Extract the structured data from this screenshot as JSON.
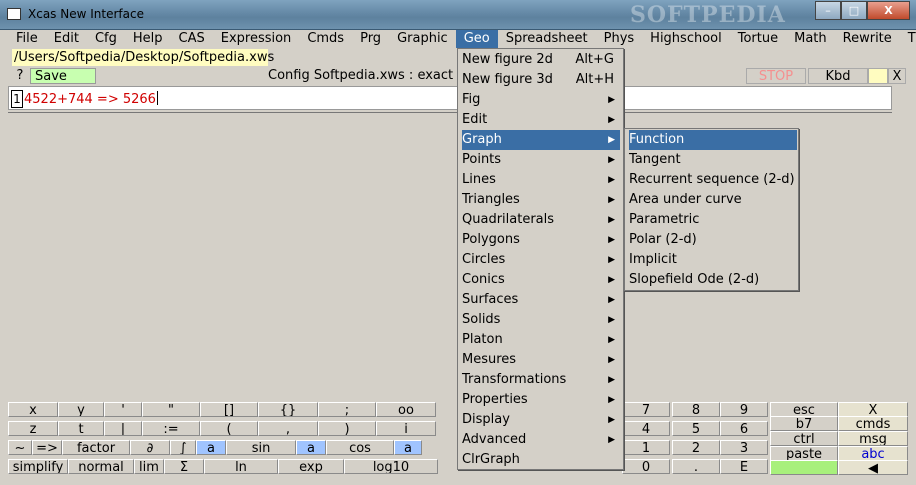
{
  "window": {
    "title": "Xcas New Interface",
    "watermark": "SOFTPEDIA",
    "min": "–",
    "max": "□",
    "close": "X"
  },
  "menubar": [
    "File",
    "Edit",
    "Cfg",
    "Help",
    "CAS",
    "Expression",
    "Cmds",
    "Prg",
    "Graphic",
    "Geo",
    "Spreadsheet",
    "Phys",
    "Highschool",
    "Tortue",
    "Math",
    "Rewrite",
    "T"
  ],
  "session": {
    "path": "/Users/Softpedia/Desktop/Softpedia.xws",
    "help": "?",
    "save": "Save",
    "config": "Config Softpedia.xws : exact re",
    "stop": "STOP",
    "kbd": "Kbd",
    "close": "X"
  },
  "editor": {
    "line": "1",
    "command": "4522+744 => 5266"
  },
  "geo_menu": [
    {
      "label": "New figure 2d",
      "shortcut": "Alt+G"
    },
    {
      "label": "New figure 3d",
      "shortcut": "Alt+H"
    },
    {
      "label": "Fig",
      "sub": true
    },
    {
      "label": "Edit",
      "sub": true
    },
    {
      "label": "Graph",
      "sub": true
    },
    {
      "label": "Points",
      "sub": true
    },
    {
      "label": "Lines",
      "sub": true
    },
    {
      "label": "Triangles",
      "sub": true
    },
    {
      "label": "Quadrilaterals",
      "sub": true
    },
    {
      "label": "Polygons",
      "sub": true
    },
    {
      "label": "Circles",
      "sub": true
    },
    {
      "label": "Conics",
      "sub": true
    },
    {
      "label": "Surfaces",
      "sub": true
    },
    {
      "label": "Solids",
      "sub": true
    },
    {
      "label": "Platon",
      "sub": true
    },
    {
      "label": "Mesures",
      "sub": true
    },
    {
      "label": "Transformations",
      "sub": true
    },
    {
      "label": "Properties",
      "sub": true
    },
    {
      "label": "Display",
      "sub": true
    },
    {
      "label": "Advanced",
      "sub": true
    },
    {
      "label": "ClrGraph",
      "sub": false
    }
  ],
  "graph_menu": [
    "Function",
    "Tangent",
    "Recurrent sequence (2-d)",
    "Area under curve",
    "Parametric",
    "Polar (2-d)",
    "Implicit",
    "Slopefield Ode (2-d)"
  ],
  "keyboard": {
    "row1": [
      "x",
      "y",
      "'",
      "\"",
      "[]",
      "{}",
      ";",
      "oo"
    ],
    "row2": [
      "z",
      "t",
      "|",
      ":=",
      "(",
      ",",
      ")",
      "i"
    ],
    "row3": [
      "~",
      "=>",
      "factor",
      "∂",
      "∫",
      "a",
      "sin",
      "a",
      "cos",
      "a"
    ],
    "row4": [
      "simplify",
      "normal",
      "lim",
      "Σ",
      "ln",
      "exp",
      "log10"
    ],
    "numpad": [
      [
        "7",
        "8",
        "9"
      ],
      [
        "4",
        "5",
        "6"
      ],
      [
        "1",
        "2",
        "3"
      ],
      [
        "0",
        ".",
        "E"
      ]
    ],
    "side": [
      [
        "esc",
        "X"
      ],
      [
        "b7",
        "cmds"
      ],
      [
        "ctrl",
        "msg"
      ],
      [
        "paste",
        "abc"
      ],
      [
        "",
        ""
      ]
    ]
  },
  "arrow": "▶",
  "left_arrow": "◀"
}
